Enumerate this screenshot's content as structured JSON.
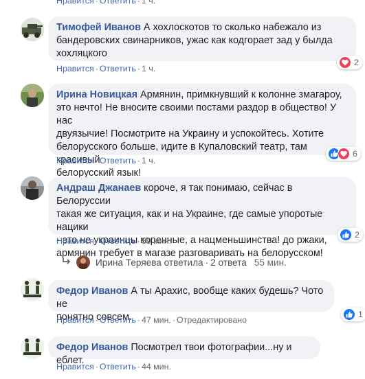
{
  "top_partial": {
    "like": "Нравится",
    "reply": "Ответить",
    "time": "1 ч."
  },
  "comments": [
    {
      "author": "Тимофей Иванов",
      "lines": [
        " А хохлоскотов то сколько набежало из",
        "бандеровских свинарников, ужас как кодгорает зад у былда",
        "хохляцкого"
      ],
      "like": "Нравится",
      "reply": "Ответить",
      "time": "1 ч.",
      "reaction": {
        "type": "heart",
        "count": "2"
      }
    },
    {
      "author": "Ирина Новицкая",
      "lines": [
        " Армянин, примкнувший к колонне змагароу,",
        "это нечто! Не вносите своими постами раздор в общество! У нас",
        "двуязычие! Посмотрите на Украину и успокойтесь. Хотите",
        "белорусского больше, идите в Купаловский театр, там красивый",
        "белорусский язык!"
      ],
      "like": "Нравится",
      "reply": "Ответить",
      "time": "1 ч.",
      "reaction": {
        "type": "like+heart",
        "count": "6"
      }
    },
    {
      "author": "Андраш Джанаев",
      "lines": [
        " короче, я так понимаю, сейчас в Белоруссии",
        "такая же ситуация, как и на Украине, где самые упоротые нацики",
        "- это не украинцы коренные, а нацменьшинства! до ржаки,",
        "армянин требует в магазе разговаривать на белорусском!"
      ],
      "like": "Нравится",
      "reply": "Ответить",
      "time": "59 мин.",
      "reaction": {
        "type": "like",
        "count": "2"
      }
    },
    {
      "author": "Федор Иванов",
      "lines": [
        " А ты Арахис, вообще каких будешь? Чото не",
        "понятно совсем."
      ],
      "like": "Нравится",
      "reply": "Ответить",
      "time": "47 мин.",
      "edited": "Отредактировано",
      "reaction": {
        "type": "like",
        "count": "1"
      }
    },
    {
      "author": "Федор Иванов",
      "lines": [
        " Посмотрел твои фотографии...ну и еблет."
      ],
      "like": "Нравится",
      "reply": "Ответить",
      "time": "44 мин."
    }
  ],
  "replies_summary": {
    "name_action": "Ирина Теряева ответила",
    "count": "2 ответа",
    "time": "55 мин."
  },
  "icons": {
    "heart": "heart-reaction-icon",
    "like": "like-reaction-icon",
    "reply_arrow": "reply-arrow-icon"
  },
  "colors": {
    "author": "#385898",
    "link": "#4267b2",
    "meta": "#65676b",
    "bubble": "#f0f2f5",
    "like_blue": "#1877f2",
    "heart_red": "#f33e58"
  }
}
